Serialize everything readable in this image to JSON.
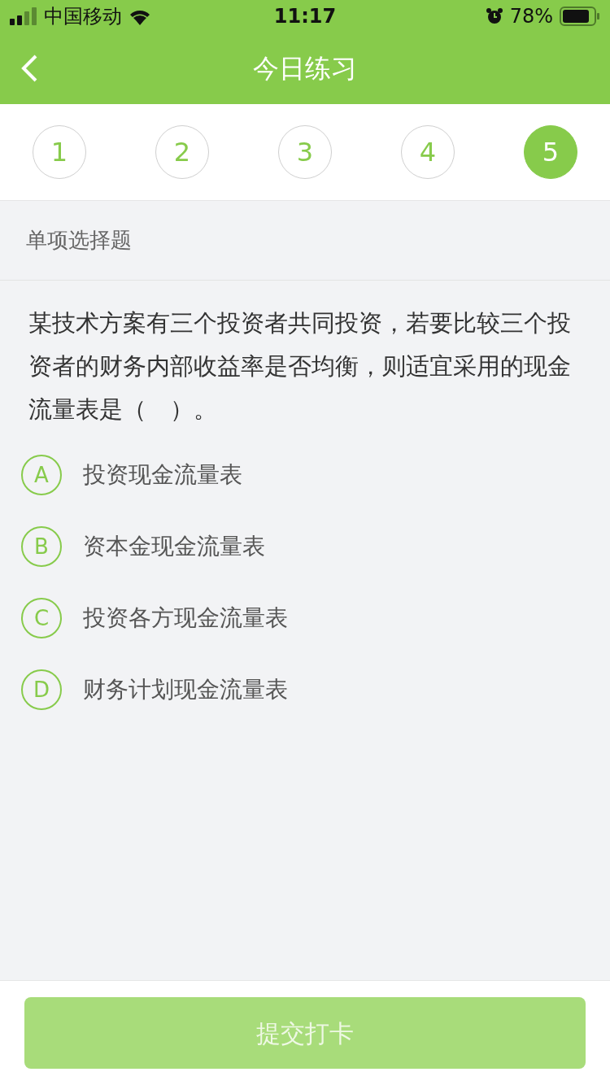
{
  "status_bar": {
    "carrier": "中国移动",
    "time": "11:17",
    "battery": "78%"
  },
  "nav": {
    "title": "今日练习"
  },
  "steps": [
    {
      "label": "1",
      "selected": false
    },
    {
      "label": "2",
      "selected": false
    },
    {
      "label": "3",
      "selected": false
    },
    {
      "label": "4",
      "selected": false
    },
    {
      "label": "5",
      "selected": true
    }
  ],
  "section": {
    "title": "单项选择题"
  },
  "question": {
    "text": "某技术方案有三个投资者共同投资，若要比较三个投资者的财务内部收益率是否均衡，则适宜采用的现金流量表是（　）。"
  },
  "options": [
    {
      "letter": "A",
      "text": "投资现金流量表",
      "selected": false
    },
    {
      "letter": "B",
      "text": "资本金现金流量表",
      "selected": false
    },
    {
      "letter": "C",
      "text": "投资各方现金流量表",
      "selected": false
    },
    {
      "letter": "D",
      "text": "财务计划现金流量表",
      "selected": false
    }
  ],
  "submit": {
    "label": "提交打卡",
    "disabled": true
  }
}
